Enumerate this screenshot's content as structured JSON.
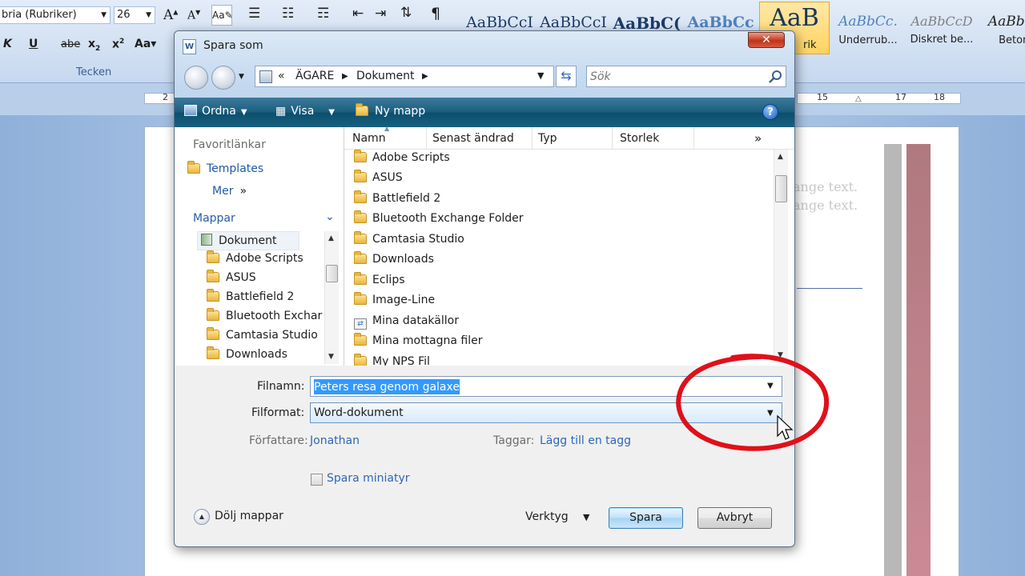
{
  "word": {
    "font_name": "bria (Rubriker)",
    "font_size": "26",
    "group_label": "Tecken",
    "styles": [
      {
        "sample": "AaBbCcI",
        "name": ""
      },
      {
        "sample": "AaBbCcI",
        "name": ""
      },
      {
        "sample": "AaBbC(",
        "name": ""
      },
      {
        "sample": "AaBbCc",
        "name": ""
      },
      {
        "sample": "AaB",
        "name": "rik"
      },
      {
        "sample": "AaBbCc.",
        "name": "Underrub..."
      },
      {
        "sample": "AaBbCcD",
        "name": "Diskret be..."
      },
      {
        "sample": "AaBbCc",
        "name": "Betoni"
      }
    ],
    "ruler_numbers": [
      "2",
      "15",
      "17",
      "18"
    ],
    "doc_text_1": "ange text.",
    "doc_text_2": "ange text."
  },
  "dialog": {
    "title": "Spara som",
    "close_label": "✕",
    "address": {
      "prefix": "«",
      "crumb1": "ÄGARE",
      "crumb2": "Dokument"
    },
    "search_placeholder": "Sök",
    "toolbar": {
      "organize": "Ordna",
      "view": "Visa",
      "new_folder": "Ny mapp",
      "help": "?"
    },
    "nav": {
      "favorites_header": "Favoritlänkar",
      "favorites": [
        "Templates",
        "Mer"
      ],
      "folders_header": "Mappar",
      "tree_root": "Dokument",
      "tree_items": [
        "Adobe Scripts",
        "ASUS",
        "Battlefield 2",
        "Bluetooth Exchar",
        "Camtasia Studio",
        "Downloads"
      ]
    },
    "columns": [
      "Namn",
      "Senast ändrad",
      "Typ",
      "Storlek"
    ],
    "files": [
      {
        "name": "Adobe Scripts",
        "icon": "folder-icon"
      },
      {
        "name": "ASUS",
        "icon": "folder-icon"
      },
      {
        "name": "Battlefield 2",
        "icon": "folder-icon"
      },
      {
        "name": "Bluetooth Exchange Folder",
        "icon": "folder-icon"
      },
      {
        "name": "Camtasia Studio",
        "icon": "folder-icon"
      },
      {
        "name": "Downloads",
        "icon": "folder-icon"
      },
      {
        "name": "Eclips",
        "icon": "folder-icon"
      },
      {
        "name": "Image-Line",
        "icon": "folder-icon"
      },
      {
        "name": "Mina datakällor",
        "icon": "data-sources-icon"
      },
      {
        "name": "Mina mottagna filer",
        "icon": "folder-icon"
      },
      {
        "name": "My NPS Fil",
        "icon": "folder-icon"
      }
    ],
    "form": {
      "filename_label": "Filnamn:",
      "filename_value": "Peters resa genom galaxen",
      "format_label": "Filformat:",
      "format_value": "Word-dokument",
      "author_label": "Författare:",
      "author_value": "Jonathan",
      "tags_label": "Taggar:",
      "tags_value": "Lägg till en tagg",
      "thumbnail_label": "Spara miniatyr",
      "hide_folders": "Dölj mappar",
      "tools": "Verktyg",
      "save": "Spara",
      "cancel": "Avbryt"
    }
  },
  "colors": {
    "toolbar": "#195d7d",
    "annotation": "#e0101a",
    "link": "#2e68b7",
    "selection": "#3399ff"
  }
}
